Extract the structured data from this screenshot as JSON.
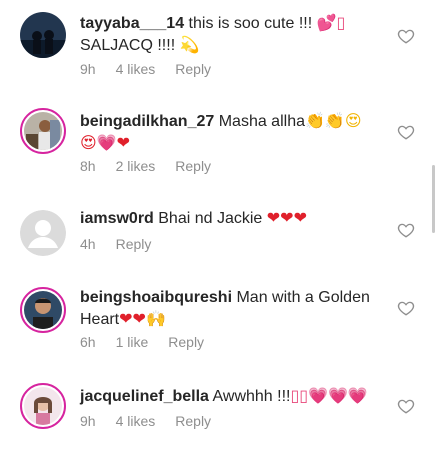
{
  "comments": [
    {
      "username": "tayyaba___14",
      "body": " this is soo cute !!! ",
      "emoji": "💕▯",
      "line2": "SALJACQ !!!! ",
      "line2_emoji": "💫",
      "time": "9h",
      "likes": "4 likes",
      "reply": "Reply"
    },
    {
      "username": "beingadilkhan_27",
      "body": " Masha allha",
      "emoji": "👏👏😍",
      "line2_emoji": "😍💗❤",
      "time": "8h",
      "likes": "2 likes",
      "reply": "Reply"
    },
    {
      "username": "iamsw0rd",
      "body": " Bhai nd Jackie ",
      "emoji": "❤❤❤",
      "time": "4h",
      "reply": "Reply"
    },
    {
      "username": "beingshoaibqureshi",
      "body": " Man with a Golden",
      "line2": "Heart",
      "line2_emoji": "❤❤🙌",
      "time": "6h",
      "likes": "1 like",
      "reply": "Reply"
    },
    {
      "username": "jacquelinef_bella",
      "body": " Awwhhh !!!",
      "emoji": "▯▯💗💗💗",
      "time": "9h",
      "likes": "4 likes",
      "reply": "Reply"
    }
  ]
}
